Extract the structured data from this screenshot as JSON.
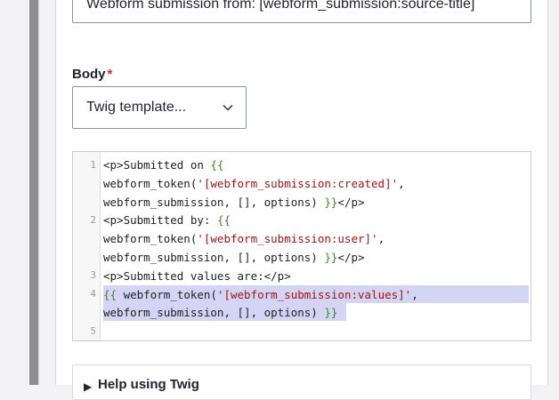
{
  "subject": {
    "value": "Webform submission from: [webform_submission:source-title]"
  },
  "body": {
    "label": "Body",
    "required_mark": "*",
    "select_value": "Twig template..."
  },
  "editor": {
    "line_numbers": [
      "1",
      "2",
      "3",
      "4",
      "5"
    ],
    "lines": [
      "<p>Submitted on {{",
      "webform_token('[webform_submission:created]',",
      "webform_submission, [], options) }}</p>",
      "<p>Submitted by: {{",
      "webform_token('[webform_submission:user]',",
      "webform_submission, [], options) }}</p>",
      "<p>Submitted values are:</p>",
      "{{ webform_token('[webform_submission:values]',",
      "webform_submission, [], options) }}"
    ]
  },
  "help": {
    "label": "Help using Twig"
  },
  "colors": {
    "twig": "#3a8a1a",
    "string": "#a31515",
    "selection": "#d4d4f5",
    "required": "#dc2323"
  }
}
